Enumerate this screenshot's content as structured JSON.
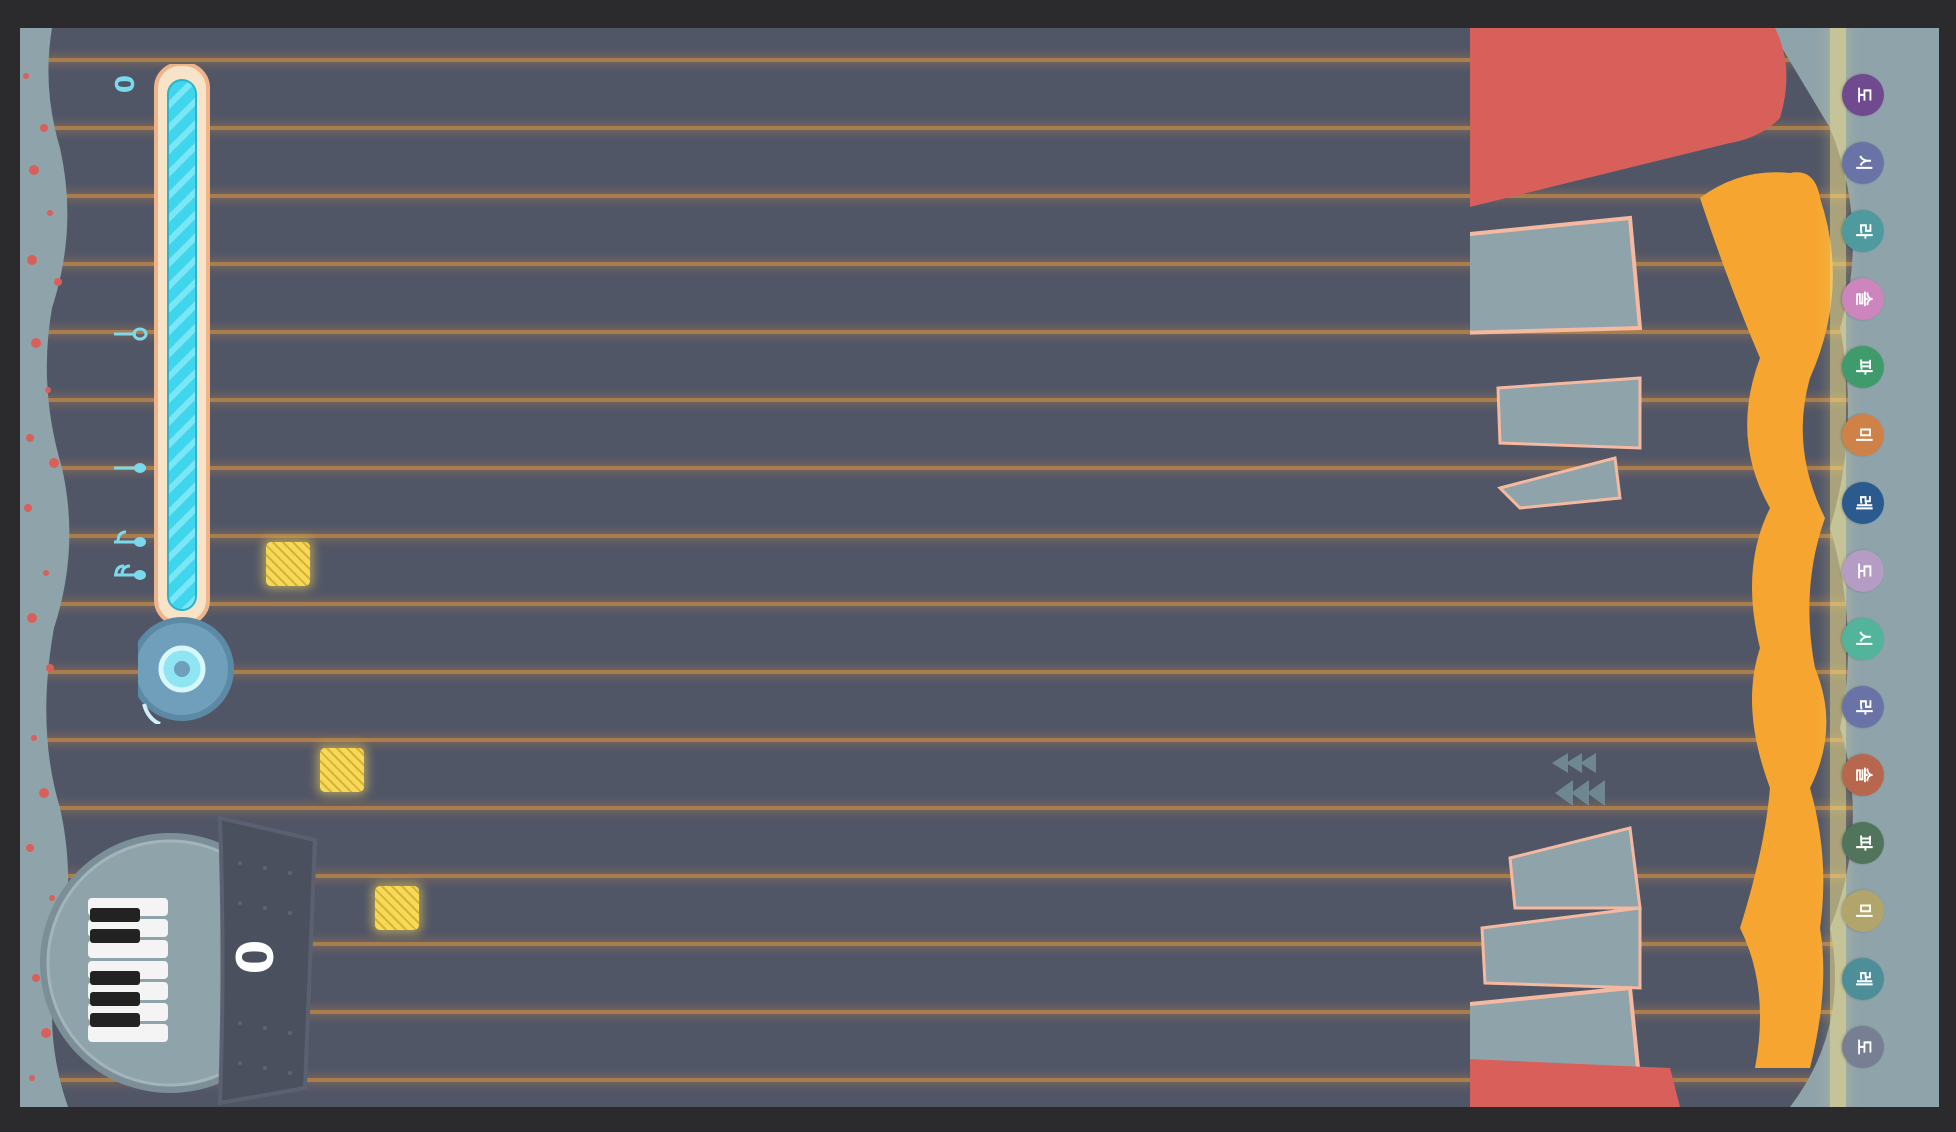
{
  "game": {
    "score": "0",
    "meter_level": 1.0,
    "meter_label_top": "0",
    "colors": {
      "background": "#515667",
      "lane_line": "#c88a44",
      "wall": "#8fa3aa",
      "curtain": "#d9605a",
      "fire": "#f6a630",
      "meter_fill": "#3fd5ec",
      "block": "#f7d955"
    }
  },
  "meter_icons": [
    "half-note-icon",
    "quarter-note-icon",
    "eighth-note-icon",
    "sixteenth-note-icon"
  ],
  "notes": [
    {
      "label": "도",
      "color": "#6f4a8e"
    },
    {
      "label": "시",
      "color": "#6a73a6"
    },
    {
      "label": "라",
      "color": "#4f9a9e"
    },
    {
      "label": "솔",
      "color": "#cc86bd"
    },
    {
      "label": "파",
      "color": "#3f9a6c"
    },
    {
      "label": "미",
      "color": "#cf8248"
    },
    {
      "label": "레",
      "color": "#2b5a8e"
    },
    {
      "label": "도",
      "color": "#b59cc4"
    },
    {
      "label": "시",
      "color": "#52b59b"
    },
    {
      "label": "라",
      "color": "#6a73a6"
    },
    {
      "label": "솔",
      "color": "#b8674f"
    },
    {
      "label": "파",
      "color": "#50755c"
    },
    {
      "label": "미",
      "color": "#b2a56b"
    },
    {
      "label": "레",
      "color": "#4e8e99"
    },
    {
      "label": "도",
      "color": "#777f93"
    }
  ]
}
